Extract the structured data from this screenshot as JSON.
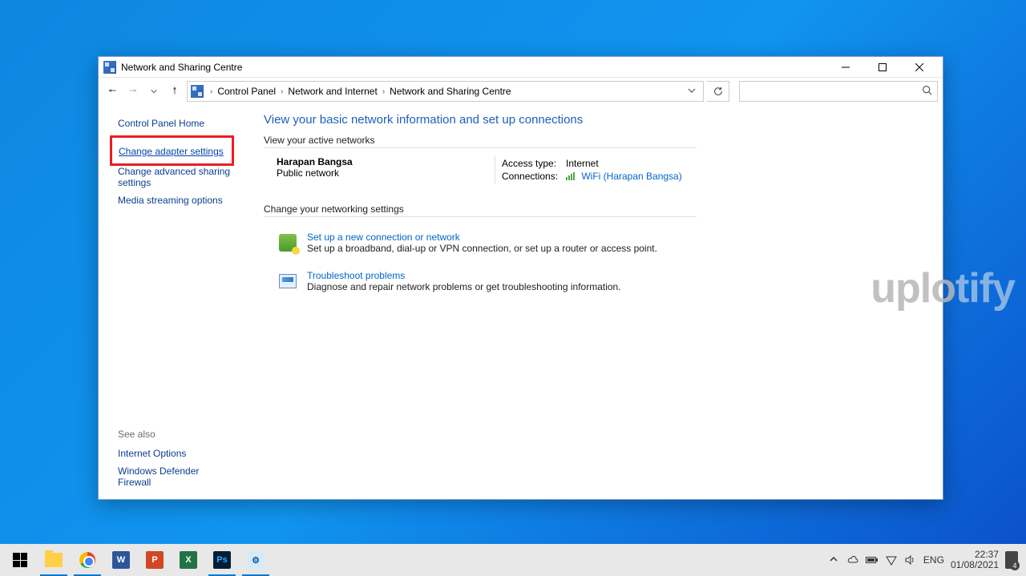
{
  "window": {
    "title": "Network and Sharing Centre"
  },
  "breadcrumb": {
    "items": [
      "Control Panel",
      "Network and Internet",
      "Network and Sharing Centre"
    ]
  },
  "sidebar": {
    "home": "Control Panel Home",
    "change_adapter": "Change adapter settings",
    "change_advanced": "Change advanced sharing settings",
    "media_streaming": "Media streaming options",
    "see_also_label": "See also",
    "internet_options": "Internet Options",
    "defender": "Windows Defender Firewall"
  },
  "main": {
    "heading": "View your basic network information and set up connections",
    "active_label": "View your active networks",
    "network": {
      "name": "Harapan Bangsa",
      "type": "Public network",
      "access_type_label": "Access type:",
      "access_type_value": "Internet",
      "connections_label": "Connections:",
      "connection_name": "WiFi (Harapan Bangsa)"
    },
    "change_label": "Change your networking settings",
    "setup": {
      "title": "Set up a new connection or network",
      "desc": "Set up a broadband, dial-up or VPN connection, or set up a router or access point."
    },
    "troubleshoot": {
      "title": "Troubleshoot problems",
      "desc": "Diagnose and repair network problems or get troubleshooting information."
    }
  },
  "watermark": {
    "pre": "uplo",
    "accent": "tify"
  },
  "taskbar": {
    "lang": "ENG",
    "time": "22:37",
    "date": "01/08/2021",
    "word": "W",
    "ppt": "P",
    "excel": "X",
    "ps": "Ps",
    "cp": "⚙"
  }
}
